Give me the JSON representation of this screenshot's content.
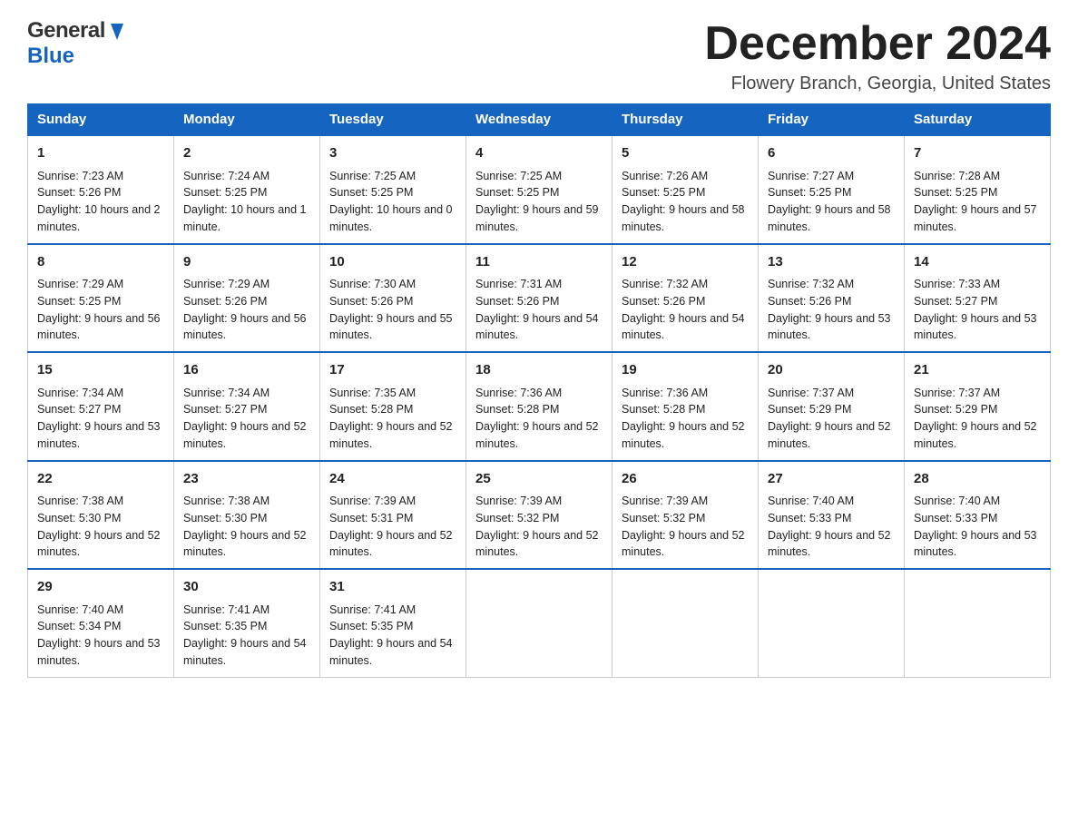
{
  "header": {
    "logo_general": "General",
    "logo_blue": "Blue",
    "month_title": "December 2024",
    "location": "Flowery Branch, Georgia, United States"
  },
  "days_of_week": [
    "Sunday",
    "Monday",
    "Tuesday",
    "Wednesday",
    "Thursday",
    "Friday",
    "Saturday"
  ],
  "weeks": [
    [
      {
        "day": "1",
        "sunrise": "7:23 AM",
        "sunset": "5:26 PM",
        "daylight": "10 hours and 2 minutes."
      },
      {
        "day": "2",
        "sunrise": "7:24 AM",
        "sunset": "5:25 PM",
        "daylight": "10 hours and 1 minute."
      },
      {
        "day": "3",
        "sunrise": "7:25 AM",
        "sunset": "5:25 PM",
        "daylight": "10 hours and 0 minutes."
      },
      {
        "day": "4",
        "sunrise": "7:25 AM",
        "sunset": "5:25 PM",
        "daylight": "9 hours and 59 minutes."
      },
      {
        "day": "5",
        "sunrise": "7:26 AM",
        "sunset": "5:25 PM",
        "daylight": "9 hours and 58 minutes."
      },
      {
        "day": "6",
        "sunrise": "7:27 AM",
        "sunset": "5:25 PM",
        "daylight": "9 hours and 58 minutes."
      },
      {
        "day": "7",
        "sunrise": "7:28 AM",
        "sunset": "5:25 PM",
        "daylight": "9 hours and 57 minutes."
      }
    ],
    [
      {
        "day": "8",
        "sunrise": "7:29 AM",
        "sunset": "5:25 PM",
        "daylight": "9 hours and 56 minutes."
      },
      {
        "day": "9",
        "sunrise": "7:29 AM",
        "sunset": "5:26 PM",
        "daylight": "9 hours and 56 minutes."
      },
      {
        "day": "10",
        "sunrise": "7:30 AM",
        "sunset": "5:26 PM",
        "daylight": "9 hours and 55 minutes."
      },
      {
        "day": "11",
        "sunrise": "7:31 AM",
        "sunset": "5:26 PM",
        "daylight": "9 hours and 54 minutes."
      },
      {
        "day": "12",
        "sunrise": "7:32 AM",
        "sunset": "5:26 PM",
        "daylight": "9 hours and 54 minutes."
      },
      {
        "day": "13",
        "sunrise": "7:32 AM",
        "sunset": "5:26 PM",
        "daylight": "9 hours and 53 minutes."
      },
      {
        "day": "14",
        "sunrise": "7:33 AM",
        "sunset": "5:27 PM",
        "daylight": "9 hours and 53 minutes."
      }
    ],
    [
      {
        "day": "15",
        "sunrise": "7:34 AM",
        "sunset": "5:27 PM",
        "daylight": "9 hours and 53 minutes."
      },
      {
        "day": "16",
        "sunrise": "7:34 AM",
        "sunset": "5:27 PM",
        "daylight": "9 hours and 52 minutes."
      },
      {
        "day": "17",
        "sunrise": "7:35 AM",
        "sunset": "5:28 PM",
        "daylight": "9 hours and 52 minutes."
      },
      {
        "day": "18",
        "sunrise": "7:36 AM",
        "sunset": "5:28 PM",
        "daylight": "9 hours and 52 minutes."
      },
      {
        "day": "19",
        "sunrise": "7:36 AM",
        "sunset": "5:28 PM",
        "daylight": "9 hours and 52 minutes."
      },
      {
        "day": "20",
        "sunrise": "7:37 AM",
        "sunset": "5:29 PM",
        "daylight": "9 hours and 52 minutes."
      },
      {
        "day": "21",
        "sunrise": "7:37 AM",
        "sunset": "5:29 PM",
        "daylight": "9 hours and 52 minutes."
      }
    ],
    [
      {
        "day": "22",
        "sunrise": "7:38 AM",
        "sunset": "5:30 PM",
        "daylight": "9 hours and 52 minutes."
      },
      {
        "day": "23",
        "sunrise": "7:38 AM",
        "sunset": "5:30 PM",
        "daylight": "9 hours and 52 minutes."
      },
      {
        "day": "24",
        "sunrise": "7:39 AM",
        "sunset": "5:31 PM",
        "daylight": "9 hours and 52 minutes."
      },
      {
        "day": "25",
        "sunrise": "7:39 AM",
        "sunset": "5:32 PM",
        "daylight": "9 hours and 52 minutes."
      },
      {
        "day": "26",
        "sunrise": "7:39 AM",
        "sunset": "5:32 PM",
        "daylight": "9 hours and 52 minutes."
      },
      {
        "day": "27",
        "sunrise": "7:40 AM",
        "sunset": "5:33 PM",
        "daylight": "9 hours and 52 minutes."
      },
      {
        "day": "28",
        "sunrise": "7:40 AM",
        "sunset": "5:33 PM",
        "daylight": "9 hours and 53 minutes."
      }
    ],
    [
      {
        "day": "29",
        "sunrise": "7:40 AM",
        "sunset": "5:34 PM",
        "daylight": "9 hours and 53 minutes."
      },
      {
        "day": "30",
        "sunrise": "7:41 AM",
        "sunset": "5:35 PM",
        "daylight": "9 hours and 54 minutes."
      },
      {
        "day": "31",
        "sunrise": "7:41 AM",
        "sunset": "5:35 PM",
        "daylight": "9 hours and 54 minutes."
      },
      null,
      null,
      null,
      null
    ]
  ],
  "labels": {
    "sunrise": "Sunrise:",
    "sunset": "Sunset:",
    "daylight": "Daylight:"
  }
}
